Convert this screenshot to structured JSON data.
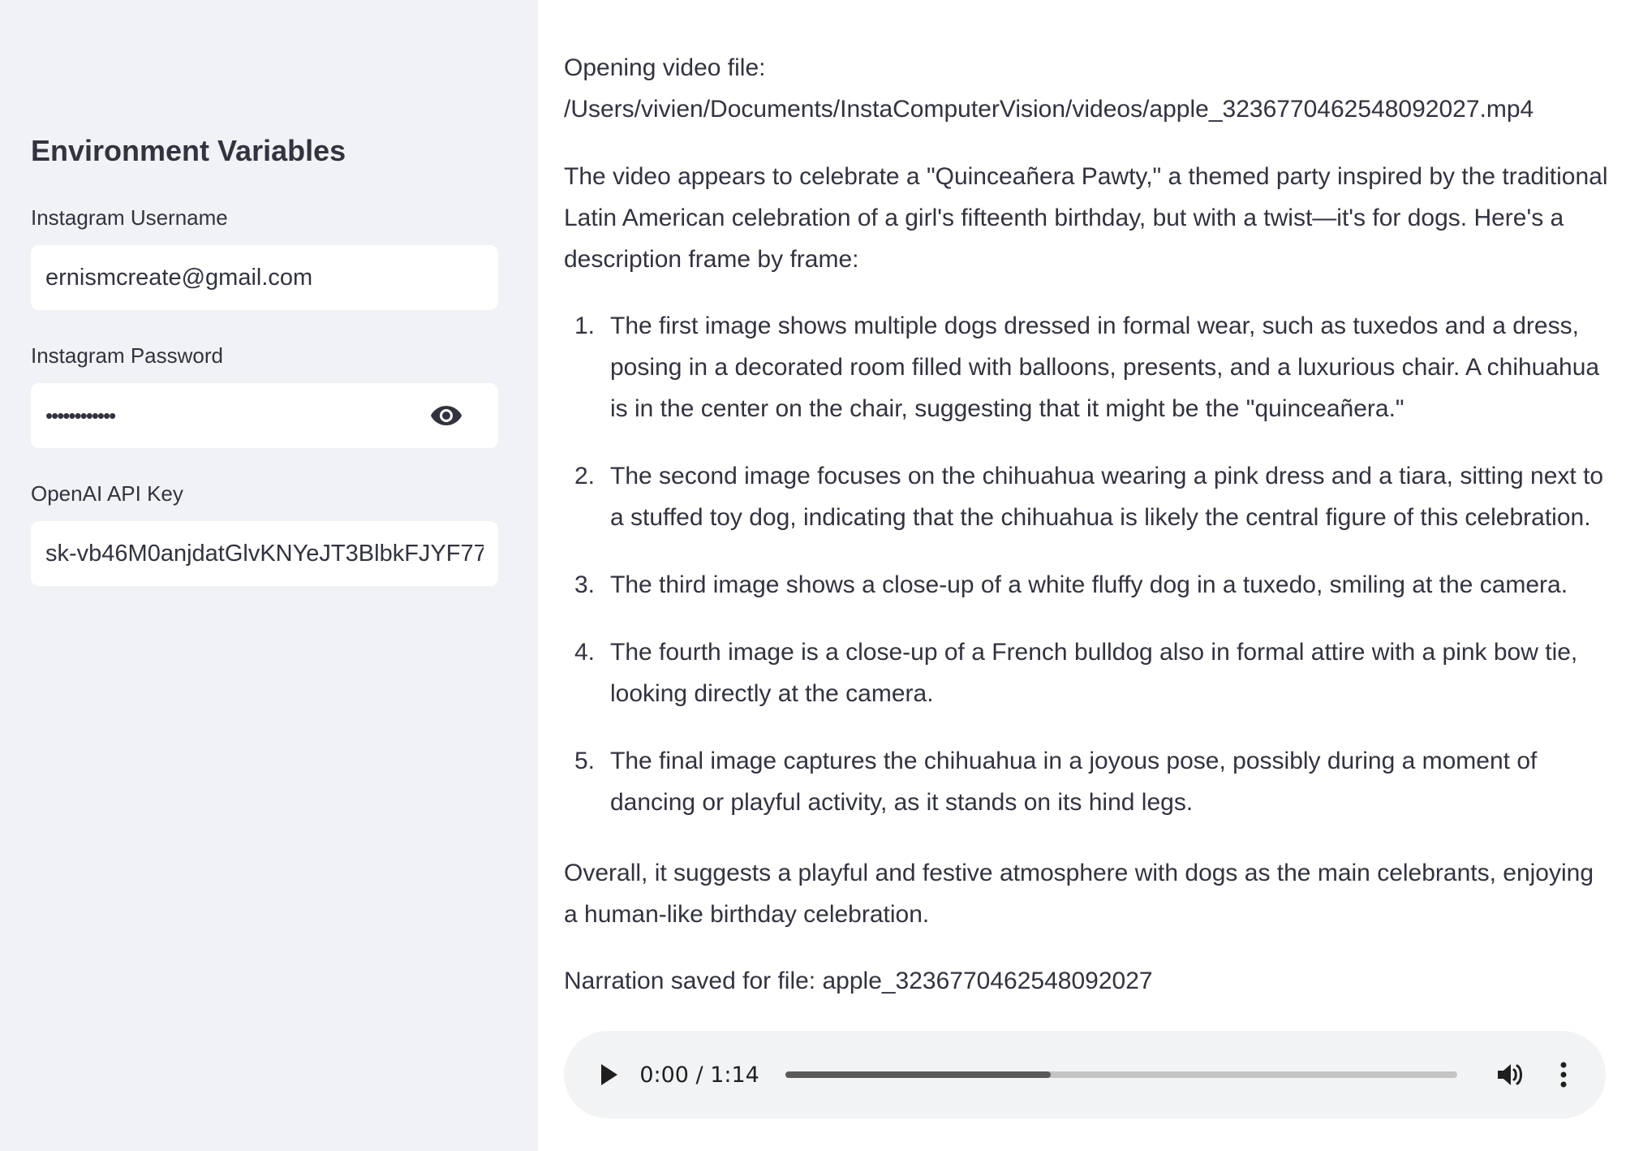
{
  "sidebar": {
    "title": "Environment Variables",
    "username": {
      "label": "Instagram Username",
      "value": "ernismcreate@gmail.com"
    },
    "password": {
      "label": "Instagram Password",
      "value": "••••••••••••",
      "toggle_icon": "eye-icon"
    },
    "api_key": {
      "label": "OpenAI API Key",
      "value": "sk-vb46M0anjdatGlvKNYeJT3BlbkFJYF77"
    }
  },
  "main": {
    "opening_line1": "Opening video file:",
    "opening_line2": "/Users/vivien/Documents/InstaComputerVision/videos/apple_3236770462548092027.mp4",
    "intro": "The video appears to celebrate a \"Quinceañera Pawty,\" a themed party inspired by the traditional Latin American celebration of a girl's fifteenth birthday, but with a twist—it's for dogs. Here's a description frame by frame:",
    "items": [
      {
        "num": "1.",
        "text": "The first image shows multiple dogs dressed in formal wear, such as tuxedos and a dress, posing in a decorated room filled with balloons, presents, and a luxurious chair. A chihuahua is in the center on the chair, suggesting that it might be the \"quinceañera.\""
      },
      {
        "num": "2.",
        "text": "The second image focuses on the chihuahua wearing a pink dress and a tiara, sitting next to a stuffed toy dog, indicating that the chihuahua is likely the central figure of this celebration."
      },
      {
        "num": "3.",
        "text": "The third image shows a close-up of a white fluffy dog in a tuxedo, smiling at the camera."
      },
      {
        "num": "4.",
        "text": "The fourth image is a close-up of a French bulldog also in formal attire with a pink bow tie, looking directly at the camera."
      },
      {
        "num": "5.",
        "text": "The final image captures the chihuahua in a joyous pose, possibly during a moment of dancing or playful activity, as it stands on its hind legs."
      }
    ],
    "overall": "Overall, it suggests a playful and festive atmosphere with dogs as the main celebrants, enjoying a human-like birthday celebration.",
    "saved": "Narration saved for file: apple_3236770462548092027"
  },
  "audio": {
    "time": "0:00 / 1:14",
    "buffered_fraction": 0.395,
    "play_icon": "play-icon",
    "volume_icon": "volume-icon",
    "more_icon": "more-vertical-icon"
  }
}
